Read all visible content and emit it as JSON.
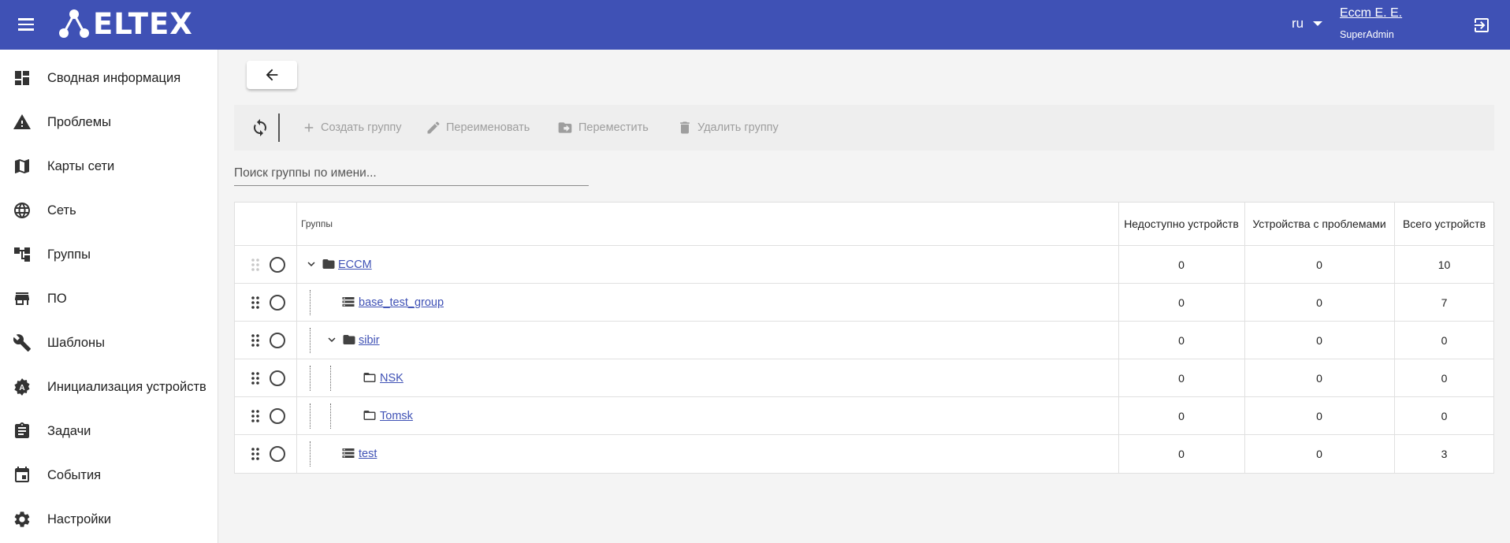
{
  "app": {
    "logo_text": "ELTEX",
    "language": "ru",
    "user_name": "Eccm E. E.",
    "user_role": "SuperAdmin"
  },
  "sidebar": {
    "items": [
      {
        "label": "Сводная информация",
        "icon": "dashboard-icon"
      },
      {
        "label": "Проблемы",
        "icon": "warning-icon"
      },
      {
        "label": "Карты сети",
        "icon": "map-icon"
      },
      {
        "label": "Сеть",
        "icon": "globe-icon"
      },
      {
        "label": "Группы",
        "icon": "groups-tree-icon"
      },
      {
        "label": "ПО",
        "icon": "store-icon"
      },
      {
        "label": "Шаблоны",
        "icon": "wrench-icon"
      },
      {
        "label": "Инициализация устройств",
        "icon": "device-init-icon"
      },
      {
        "label": "Задачи",
        "icon": "clipboard-icon"
      },
      {
        "label": "События",
        "icon": "calendar-icon"
      },
      {
        "label": "Настройки",
        "icon": "gear-icon"
      }
    ]
  },
  "toolbar": {
    "create_label": "Создать группу",
    "rename_label": "Переименовать",
    "move_label": "Переместить",
    "delete_label": "Удалить группу"
  },
  "search": {
    "placeholder": "Поиск группы по имени..."
  },
  "table": {
    "headers": {
      "groups": "Группы",
      "unavailable": "Недоступно устройств",
      "problems": "Устройства с проблемами",
      "total": "Всего устройств"
    },
    "rows": [
      {
        "name": "ECCM",
        "unavailable": "0",
        "problems": "0",
        "total": "10"
      },
      {
        "name": "base_test_group",
        "unavailable": "0",
        "problems": "0",
        "total": "7"
      },
      {
        "name": "sibir",
        "unavailable": "0",
        "problems": "0",
        "total": "0"
      },
      {
        "name": "NSK",
        "unavailable": "0",
        "problems": "0",
        "total": "0"
      },
      {
        "name": "Tomsk",
        "unavailable": "0",
        "problems": "0",
        "total": "0"
      },
      {
        "name": "test",
        "unavailable": "0",
        "problems": "0",
        "total": "3"
      }
    ]
  }
}
